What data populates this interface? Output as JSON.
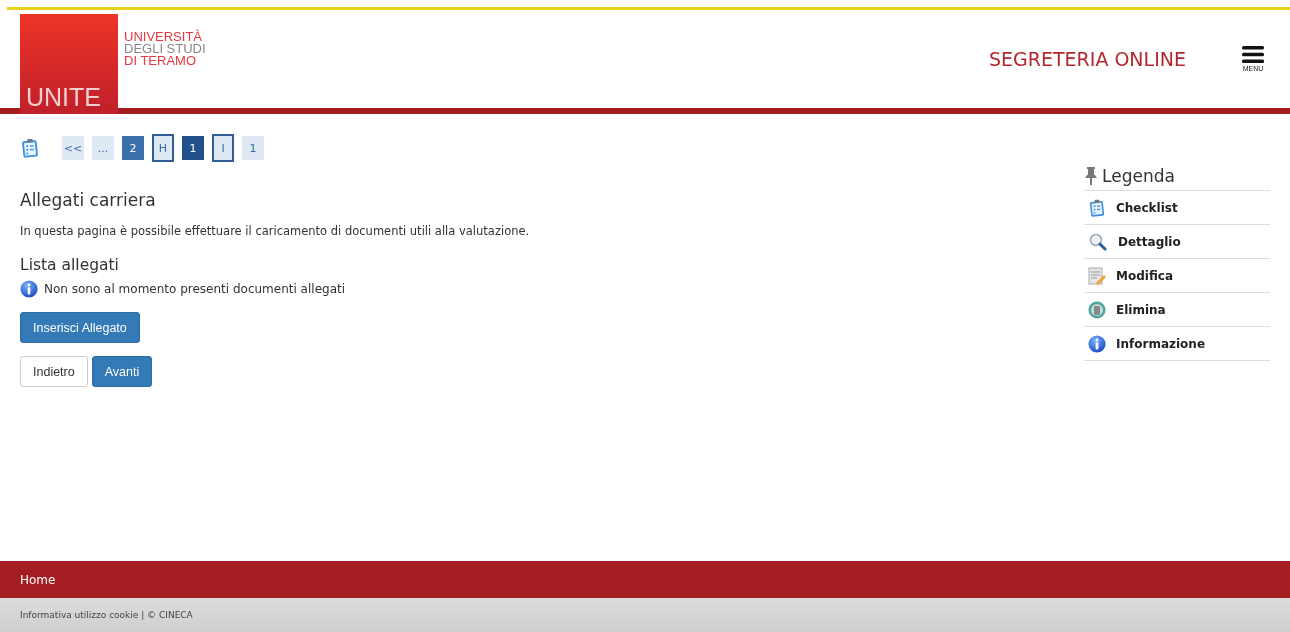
{
  "header": {
    "logo_mark": "UNITE",
    "logo_lines": [
      {
        "text": "UNIVERSITÀ",
        "kind": "accent"
      },
      {
        "text": "DEGLI STUDI",
        "kind": "muted"
      },
      {
        "text": "DI TERAMO",
        "kind": "accent"
      }
    ],
    "title": "SEGRETERIA ONLINE",
    "menu_label": "MENU"
  },
  "steps": [
    {
      "label": "<<",
      "kind": "light"
    },
    {
      "label": "...",
      "kind": "light"
    },
    {
      "label": "2",
      "kind": "done"
    },
    {
      "label": "H",
      "kind": "outline"
    },
    {
      "label": "1",
      "kind": "current"
    },
    {
      "label": "I",
      "kind": "outline"
    },
    {
      "label": "1",
      "kind": "light"
    }
  ],
  "page_title": "Allegati carriera",
  "intro": "In questa pagina è possibile effettuare il caricamento di documenti utili alla valutazione.",
  "list_title": "Lista allegati",
  "info_message": "Non sono al momento presenti documenti allegati",
  "insert_button": "Inserisci Allegato",
  "nav_buttons": [
    {
      "label": "Indietro",
      "kind": "secondary"
    },
    {
      "label": "Avanti",
      "kind": "primary"
    }
  ],
  "legend": {
    "title": "Legenda",
    "items": [
      {
        "label": "Checklist",
        "kind": "checklist"
      },
      {
        "label": "Dettaglio",
        "kind": "detail"
      },
      {
        "label": "Modifica",
        "kind": "edit"
      },
      {
        "label": "Elimina",
        "kind": "delete"
      },
      {
        "label": "Informazione",
        "kind": "info"
      }
    ]
  },
  "footer": {
    "home_link": "Home",
    "legal": "Informativa utilizzo cookie | © CINECA"
  }
}
